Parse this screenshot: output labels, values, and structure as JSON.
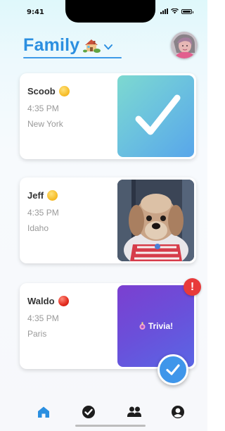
{
  "status_bar": {
    "time": "9:41"
  },
  "header": {
    "title": "Family",
    "title_icon": "house-icon",
    "dropdown_icon": "chevron-down-icon",
    "avatar": "avatar"
  },
  "members": [
    {
      "name": "Scoob",
      "emoji": "smiling-face-icon",
      "time": "4:35 PM",
      "location": "New York",
      "panel": "checkmark"
    },
    {
      "name": "Jeff",
      "emoji": "smiling-face-icon",
      "time": "4:35 PM",
      "location": "Idaho",
      "panel": "dog-photo"
    },
    {
      "name": "Waldo",
      "emoji": "red-circle-icon",
      "time": "4:35 PM",
      "location": "Paris",
      "panel": "trivia"
    }
  ],
  "trivia": {
    "label": "Trivia!",
    "alert": "!"
  },
  "tab_bar": {
    "items": [
      "home-icon",
      "check-circle-icon",
      "people-icon",
      "profile-icon"
    ],
    "active": "home-icon"
  },
  "colors": {
    "accent": "#2b8fe0",
    "alert": "#e83a3a",
    "trivia_start": "#7b3fd0",
    "trivia_end": "#5a66e5"
  }
}
